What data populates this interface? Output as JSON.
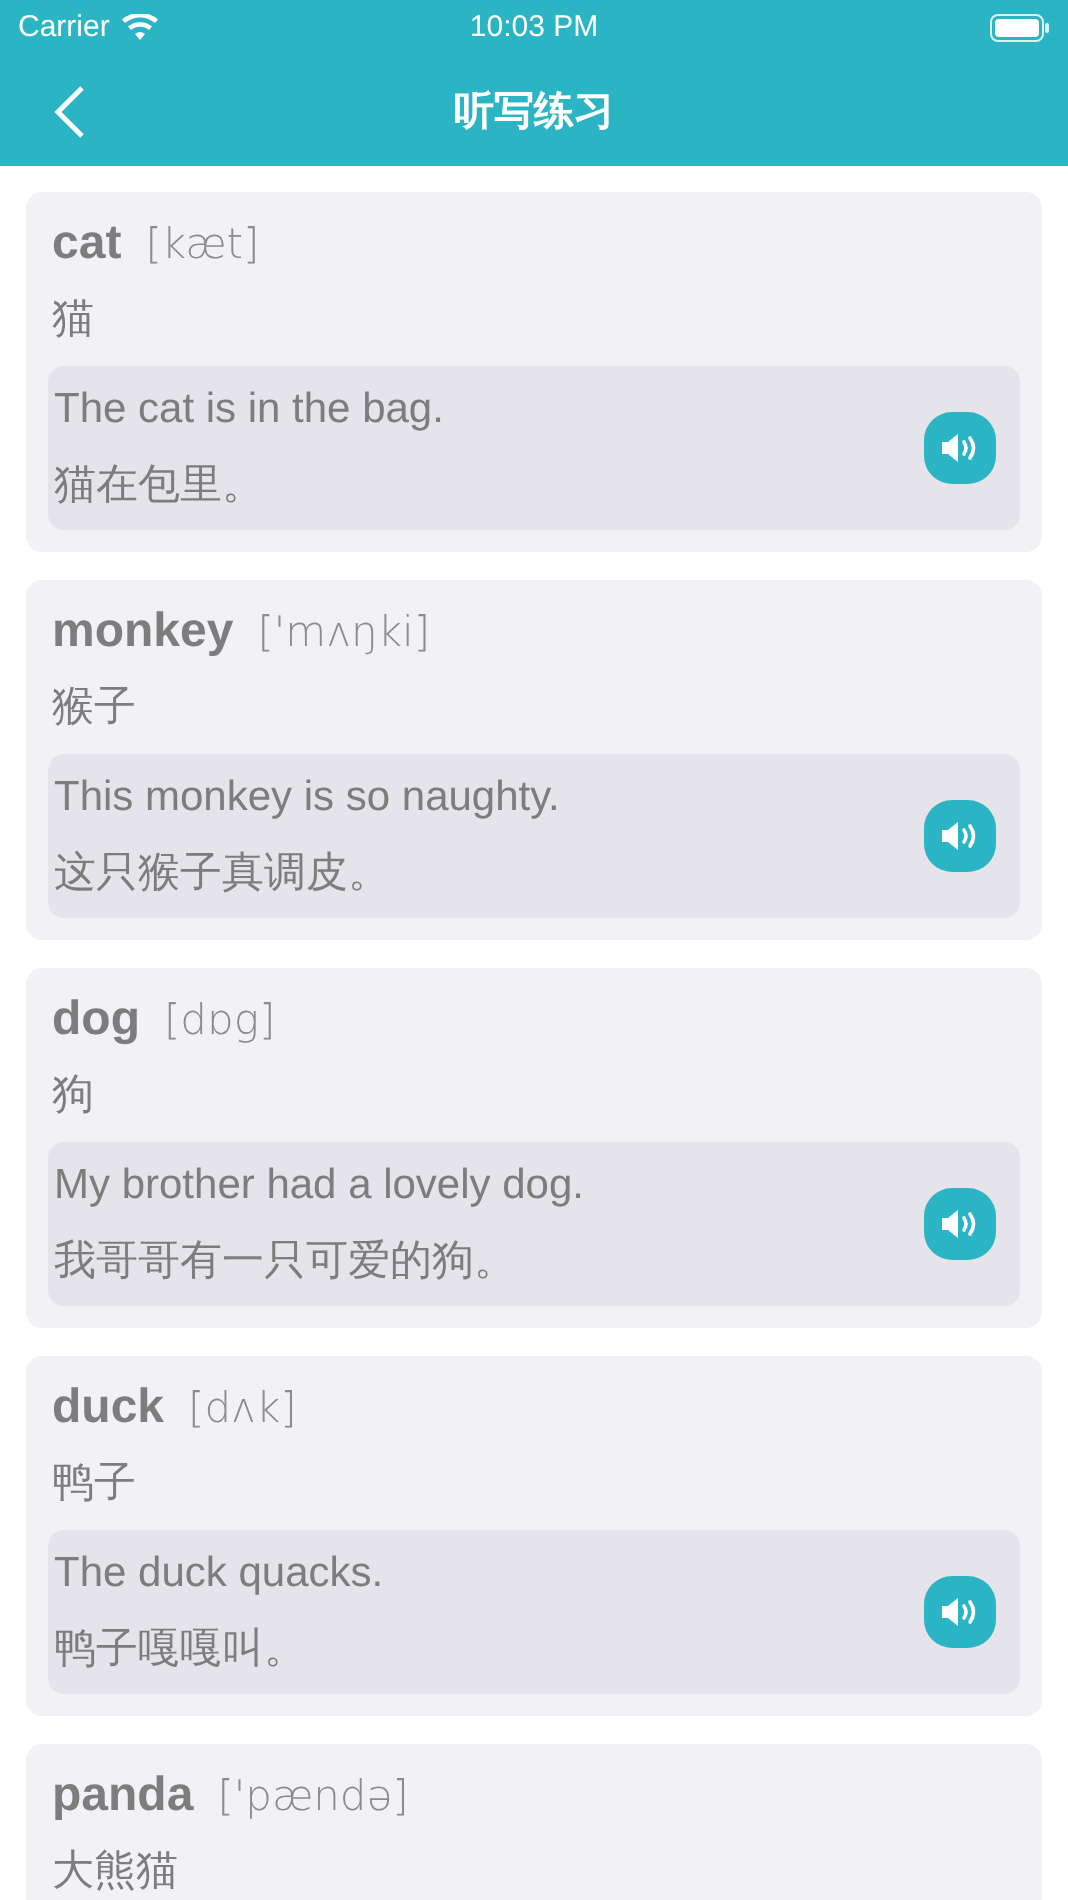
{
  "status_bar": {
    "carrier": "Carrier",
    "time": "10:03 PM"
  },
  "nav": {
    "title": "听写练习"
  },
  "words": [
    {
      "word": "cat",
      "phonetic": "[kæt]",
      "meaning": "猫",
      "example": {
        "en": "The cat is in the bag.",
        "zh": "猫在包里。"
      }
    },
    {
      "word": "monkey",
      "phonetic": "['mʌŋki]",
      "meaning": "猴子",
      "example": {
        "en": "This monkey is so naughty.",
        "zh": "这只猴子真调皮。"
      }
    },
    {
      "word": "dog",
      "phonetic": "[dɒg]",
      "meaning": "狗",
      "example": {
        "en": "My brother had a lovely dog.",
        "zh": "我哥哥有一只可爱的狗。"
      }
    },
    {
      "word": "duck",
      "phonetic": "[dʌk]",
      "meaning": "鸭子",
      "example": {
        "en": "The duck quacks.",
        "zh": "鸭子嘎嘎叫。"
      }
    },
    {
      "word": "panda",
      "phonetic": "['pændə]",
      "meaning": "大熊猫"
    }
  ]
}
